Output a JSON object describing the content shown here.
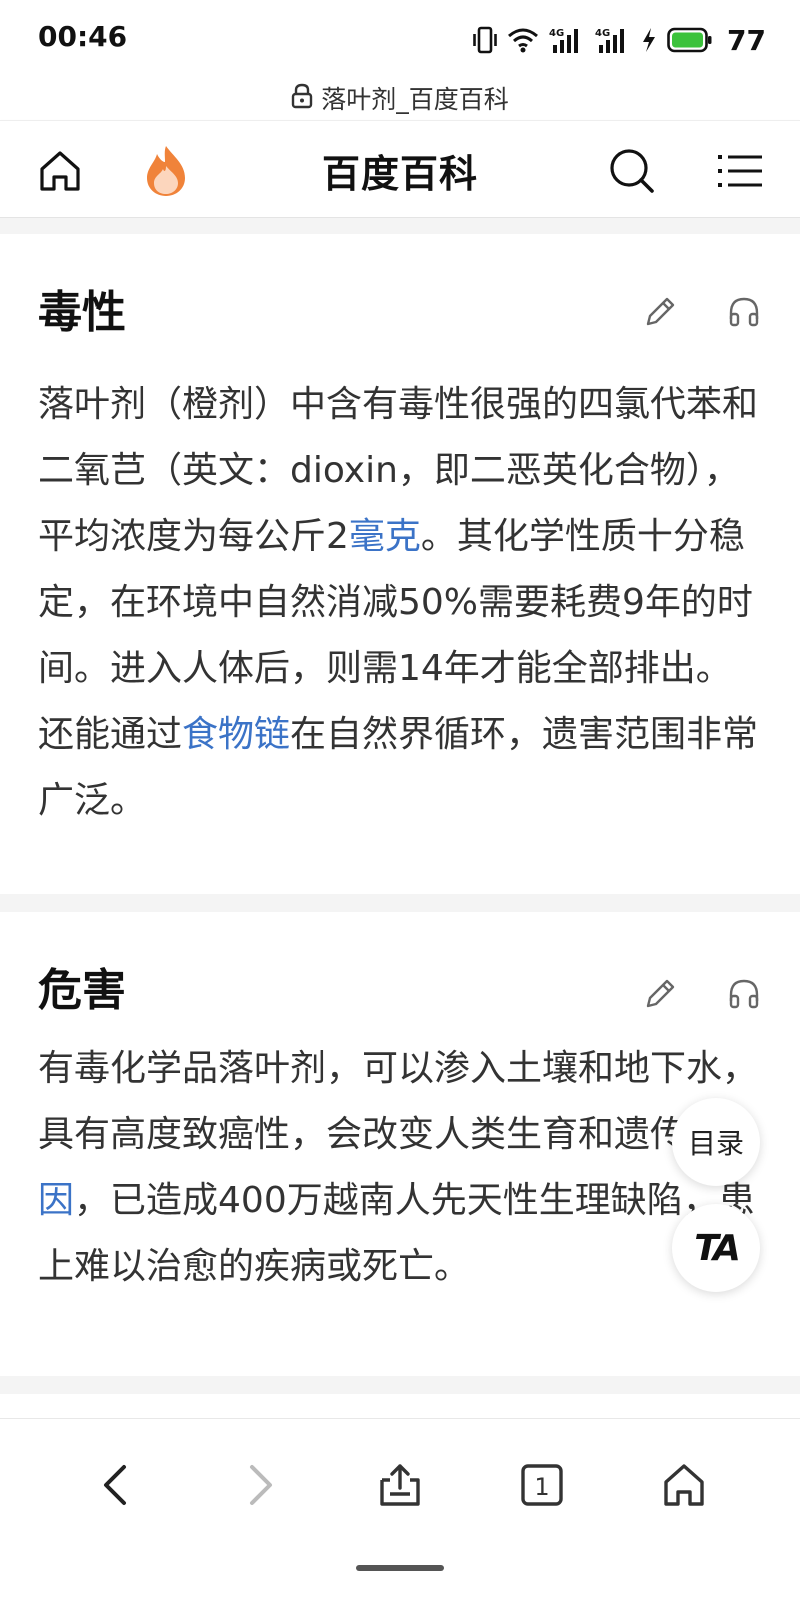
{
  "status_bar": {
    "time": "00:46",
    "battery": "77",
    "icons": [
      "vibrate-icon",
      "wifi-icon",
      "signal-4g-icon",
      "signal-4g-icon",
      "charging-icon",
      "battery-icon"
    ],
    "signal_label_1": "4G",
    "signal_label_2": "4G"
  },
  "url_bar": {
    "icon": "lock-icon",
    "title": "落叶剂_百度百科"
  },
  "header": {
    "title": "百度百科",
    "home_icon": "home-icon",
    "hot_icon": "flame-icon",
    "search_icon": "search-icon",
    "menu_icon": "menu-icon"
  },
  "sections": [
    {
      "title": "毒性",
      "edit_icon": "pencil-icon",
      "audio_icon": "headphones-icon",
      "text_parts": {
        "p1": "落叶剂（橙剂）中含有毒性很强的四氯代苯和二氧芑（英文：dioxin，即二恶英化合物），平均浓度为每公斤2",
        "link1": "毫克",
        "p2": "。其化学性质十分稳定，在环境中自然消减50%需要耗费9年的时间。进入人体后，则需14年才能全部排出。还能通过",
        "link2": "食物链",
        "p3": "在自然界循环，遗害范围非常广泛。"
      }
    },
    {
      "title": "危害",
      "edit_icon": "pencil-icon",
      "audio_icon": "headphones-icon",
      "text_parts": {
        "p1": "有毒化学品落叶剂，可以渗入土壤和地下水，具有高度致癌性，会改变人类生育和遗传",
        "link1": "基因",
        "p2": "，已造成400万越南人先天性生理缺陷，患上难以治愈的疾病或死亡。"
      }
    }
  ],
  "floating": {
    "toc_label": "目录",
    "ta_label": "TA"
  },
  "bottom_nav": {
    "back_icon": "chevron-left-icon",
    "forward_icon": "chevron-right-icon",
    "share_icon": "share-icon",
    "tabs_count": "1",
    "home_icon": "home-icon"
  },
  "colors": {
    "link": "#3b73c7",
    "flame": "#f0833a",
    "battery": "#3bc23b",
    "gap": "#f4f4f4"
  }
}
